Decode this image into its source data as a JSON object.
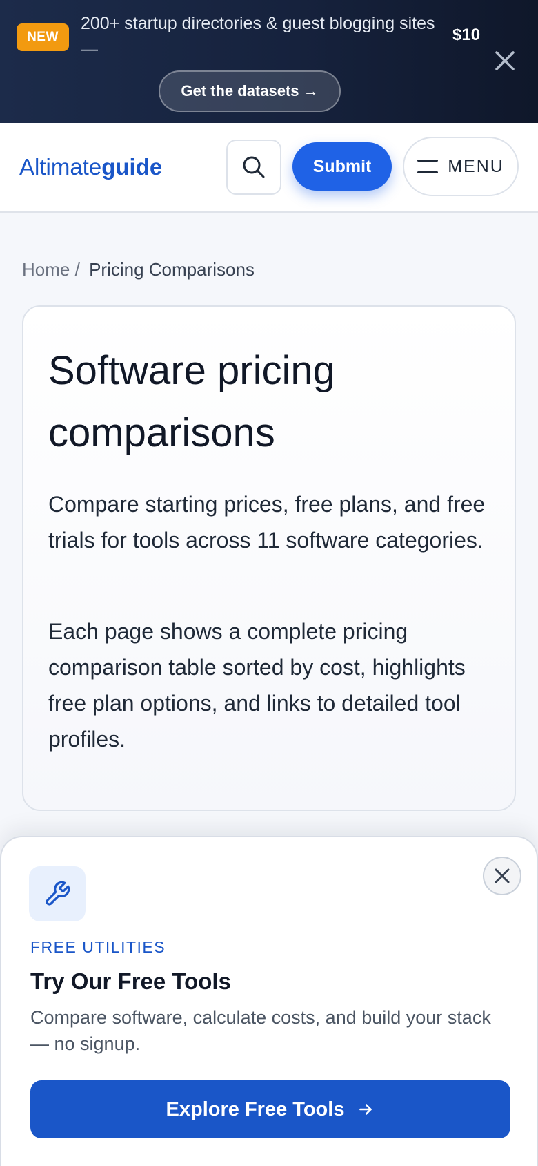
{
  "promo": {
    "badge": "NEW",
    "text": "200+ startup directories & guest blogging sites —",
    "price": "$10",
    "cta_label": "Get the datasets →"
  },
  "header": {
    "logo_part1": "Altimate",
    "logo_part2": "guide",
    "submit_label": "Submit",
    "menu_label": "MENU"
  },
  "breadcrumb": {
    "home": "Home",
    "separator": "/",
    "current": "Pricing Comparisons"
  },
  "intro": {
    "title": "Software pricing comparisons",
    "paragraph1": "Compare starting prices, free plans, and free trials for tools across 11 software categories.",
    "paragraph2": "Each page shows a complete pricing comparison table sorted by cost, highlights free plan options, and links to detailed tool profiles."
  },
  "sheet": {
    "eyebrow": "FREE UTILITIES",
    "title": "Try Our Free Tools",
    "description": "Compare software, calculate costs, and build your stack — no signup.",
    "cta_label": "Explore Free Tools"
  },
  "icons": {
    "close": "close-icon",
    "search": "search-icon",
    "menu": "hamburger-icon",
    "tool": "wrench-icon",
    "arrow": "arrow-right-icon"
  },
  "colors": {
    "accent": "#1f62e6",
    "brand": "#1a56c8",
    "badge": "#f29a10",
    "banner": "#16223d"
  }
}
